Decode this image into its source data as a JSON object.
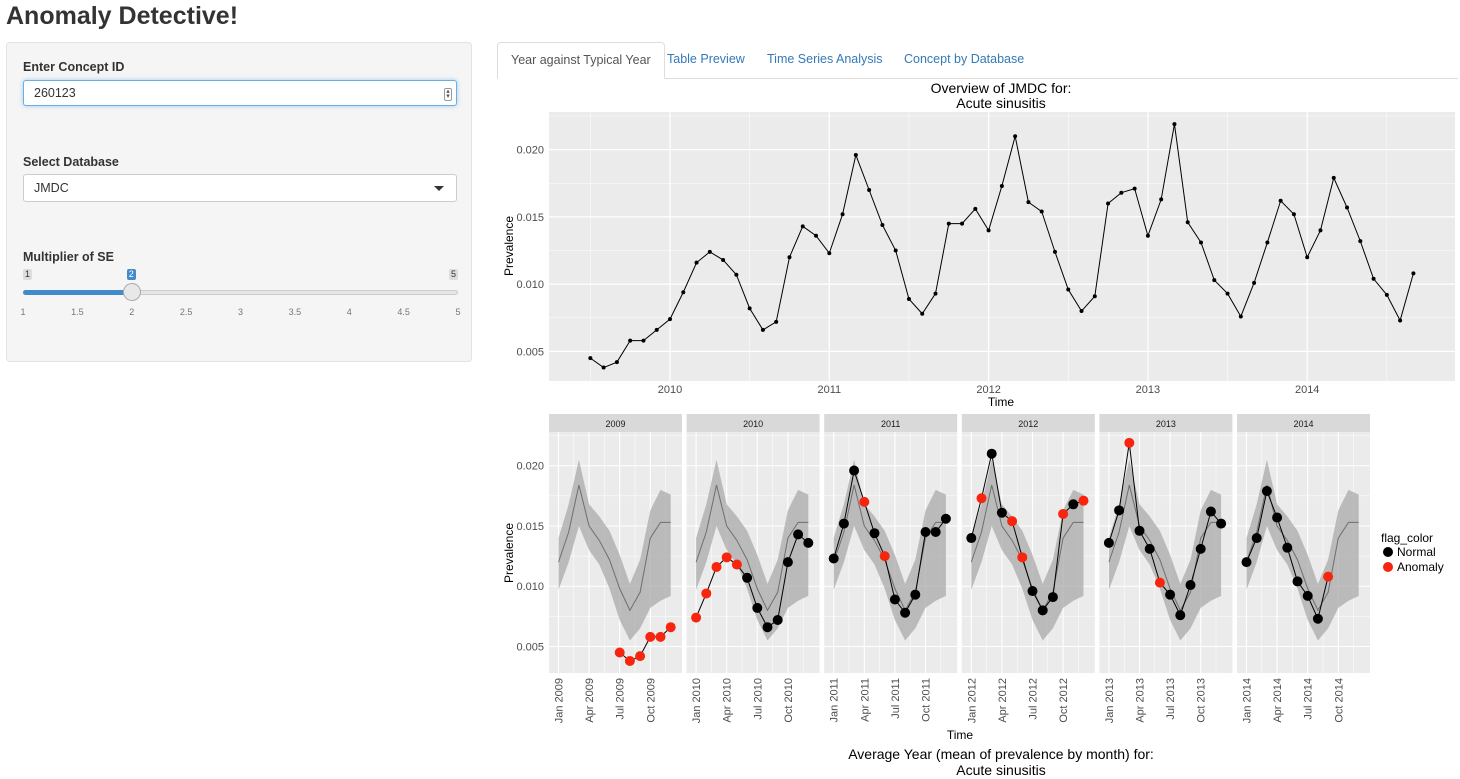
{
  "app": {
    "title": "Anomaly Detective!"
  },
  "sidebar": {
    "concept_label": "Enter Concept ID",
    "concept_value": "260123",
    "database_label": "Select Database",
    "database_value": "JMDC",
    "slider_label": "Multiplier of SE",
    "slider_min": "1",
    "slider_max": "5",
    "slider_value": "2",
    "slider_fraction": 0.25,
    "slider_ticks": [
      "1",
      "1.5",
      "2",
      "2.5",
      "3",
      "3.5",
      "4",
      "4.5",
      "5"
    ]
  },
  "tabs": [
    "Year against Typical Year",
    "Table Preview",
    "Time Series Analysis",
    "Concept by Database"
  ],
  "active_tab": 0,
  "colors": {
    "normal": "#000000",
    "anomaly": "#f8250e",
    "link": "#337ab7",
    "panel_bg": "#ebebeb",
    "ribbon": "#bdbdbd",
    "strip": "#d9d9d9"
  },
  "chart_data": [
    {
      "type": "line",
      "title": "Overview of JMDC for:",
      "subtitle": "Acute sinusitis",
      "xlabel": "Time",
      "ylabel": "Prevalence",
      "x_ticks": [
        "2010",
        "2011",
        "2012",
        "2013",
        "2014"
      ],
      "y_ticks": [
        "0.005",
        "0.010",
        "0.015",
        "0.020"
      ],
      "ylim": [
        0.0028,
        0.0228
      ],
      "start": "2009-07",
      "values": [
        0.0045,
        0.0038,
        0.0042,
        0.0058,
        0.0058,
        0.0066,
        0.0074,
        0.0094,
        0.0116,
        0.0124,
        0.0118,
        0.0107,
        0.0082,
        0.0066,
        0.0072,
        0.012,
        0.0143,
        0.0136,
        0.0123,
        0.0152,
        0.0196,
        0.017,
        0.0144,
        0.0125,
        0.0089,
        0.0078,
        0.0093,
        0.0145,
        0.0145,
        0.0156,
        0.014,
        0.0173,
        0.021,
        0.0161,
        0.0154,
        0.0124,
        0.0096,
        0.008,
        0.0091,
        0.016,
        0.0168,
        0.0171,
        0.0136,
        0.0163,
        0.0219,
        0.0146,
        0.0131,
        0.0103,
        0.0093,
        0.0076,
        0.0101,
        0.0131,
        0.0162,
        0.0152,
        0.012,
        0.014,
        0.0179,
        0.0157,
        0.0132,
        0.0104,
        0.0092,
        0.0073,
        0.0108
      ]
    },
    {
      "type": "scatter",
      "title": "Average Year (mean of prevalence by month) for:",
      "subtitle": "Acute sinusitis",
      "xlabel": "Time",
      "ylabel": "Prevalence",
      "y_ticks": [
        "0.005",
        "0.010",
        "0.015",
        "0.020"
      ],
      "ylim": [
        0.0028,
        0.0228
      ],
      "legend_title": "flag_color",
      "legend": [
        "Normal",
        "Anomaly"
      ],
      "facets": [
        "2009",
        "2010",
        "2011",
        "2012",
        "2013",
        "2014"
      ],
      "month_ticks": [
        "Jan",
        "Apr",
        "Jul",
        "Oct"
      ],
      "typical_mean": [
        0.012,
        0.0145,
        0.0184,
        0.015,
        0.0138,
        0.0122,
        0.0098,
        0.008,
        0.0095,
        0.014,
        0.0153,
        0.0153
      ],
      "typical_lower": [
        0.0097,
        0.012,
        0.015,
        0.013,
        0.0118,
        0.0098,
        0.0072,
        0.0055,
        0.0065,
        0.0082,
        0.0088,
        0.0092
      ],
      "typical_upper": [
        0.014,
        0.0168,
        0.0205,
        0.0168,
        0.0158,
        0.0146,
        0.0126,
        0.0102,
        0.0122,
        0.0163,
        0.018,
        0.0176
      ],
      "years": [
        {
          "year": "2009",
          "start_month": 7,
          "values": [
            0.0045,
            0.0038,
            0.0042,
            0.0058,
            0.0058,
            0.0066
          ],
          "flags": [
            "Anomaly",
            "Anomaly",
            "Anomaly",
            "Anomaly",
            "Anomaly",
            "Anomaly"
          ]
        },
        {
          "year": "2010",
          "start_month": 1,
          "values": [
            0.0074,
            0.0094,
            0.0116,
            0.0124,
            0.0118,
            0.0107,
            0.0082,
            0.0066,
            0.0072,
            0.012,
            0.0143,
            0.0136
          ],
          "flags": [
            "Anomaly",
            "Anomaly",
            "Anomaly",
            "Anomaly",
            "Anomaly",
            "Normal",
            "Normal",
            "Normal",
            "Normal",
            "Normal",
            "Normal",
            "Normal"
          ]
        },
        {
          "year": "2011",
          "start_month": 1,
          "values": [
            0.0123,
            0.0152,
            0.0196,
            0.017,
            0.0144,
            0.0125,
            0.0089,
            0.0078,
            0.0093,
            0.0145,
            0.0145,
            0.0156
          ],
          "flags": [
            "Normal",
            "Normal",
            "Normal",
            "Anomaly",
            "Normal",
            "Anomaly",
            "Normal",
            "Normal",
            "Normal",
            "Normal",
            "Normal",
            "Normal"
          ]
        },
        {
          "year": "2012",
          "start_month": 1,
          "values": [
            0.014,
            0.0173,
            0.021,
            0.0161,
            0.0154,
            0.0124,
            0.0096,
            0.008,
            0.0091,
            0.016,
            0.0168,
            0.0171
          ],
          "flags": [
            "Normal",
            "Anomaly",
            "Normal",
            "Normal",
            "Anomaly",
            "Anomaly",
            "Normal",
            "Normal",
            "Normal",
            "Anomaly",
            "Normal",
            "Anomaly"
          ]
        },
        {
          "year": "2013",
          "start_month": 1,
          "values": [
            0.0136,
            0.0163,
            0.0219,
            0.0146,
            0.0131,
            0.0103,
            0.0093,
            0.0076,
            0.0101,
            0.0131,
            0.0162,
            0.0152
          ],
          "flags": [
            "Normal",
            "Normal",
            "Anomaly",
            "Normal",
            "Normal",
            "Anomaly",
            "Normal",
            "Normal",
            "Normal",
            "Normal",
            "Normal",
            "Normal"
          ]
        },
        {
          "year": "2014",
          "start_month": 1,
          "values": [
            0.012,
            0.014,
            0.0179,
            0.0157,
            0.0132,
            0.0104,
            0.0092,
            0.0073,
            0.0108
          ],
          "flags": [
            "Normal",
            "Normal",
            "Normal",
            "Normal",
            "Normal",
            "Normal",
            "Normal",
            "Normal",
            "Anomaly"
          ]
        }
      ]
    }
  ]
}
